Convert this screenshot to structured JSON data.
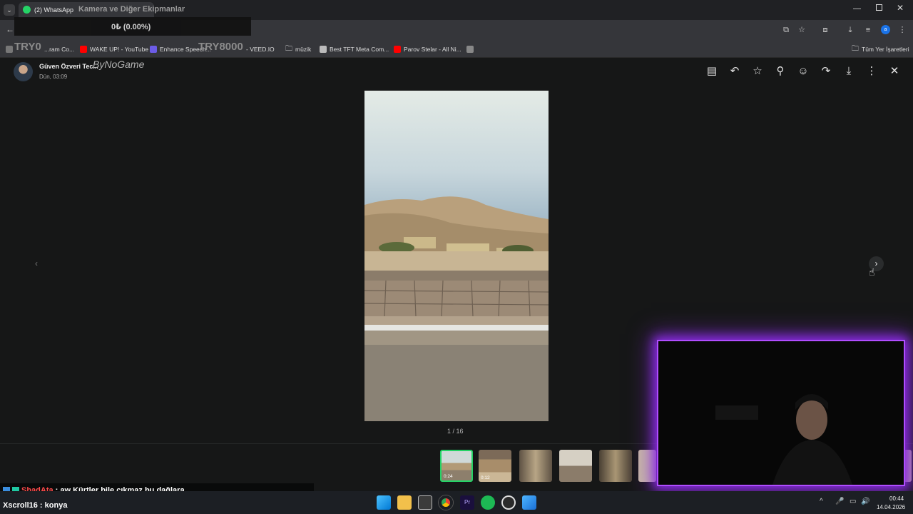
{
  "browser": {
    "tab_title": "(2) WhatsApp",
    "stream_title": "Kamera ve Diğer Ekipmanlar",
    "bookmarks": [
      {
        "label": "...ram Co...",
        "color": "#777777"
      },
      {
        "label": "WAKE UP! - YouTube",
        "color": "#ff0000"
      },
      {
        "label": "Enhance Speech...",
        "color": "#6c5ce7"
      },
      {
        "label": "- VEED.IO",
        "color": "#4caf50"
      },
      {
        "label": "müzik",
        "color": "#cccccc"
      },
      {
        "label": "Best TFT Meta Com...",
        "color": "#bbbbbb"
      },
      {
        "label": "Parov Stelar - All Ni...",
        "color": "#ff0000"
      }
    ],
    "all_bookmarks": "Tüm Yer İşaretleri"
  },
  "overlay": {
    "balance": "0₺ (0.00%)",
    "left_tag": "TRY0",
    "mid_tag": "TRY8000",
    "brand": "ByNoGame"
  },
  "viewer": {
    "sender_name": "Güven Özveri Tec...",
    "timestamp": "Dün, 03:09",
    "counter": "1 / 16",
    "thumbnails": [
      {
        "duration": "0:24",
        "selected": true
      },
      {
        "duration": "0:12",
        "selected": false
      },
      {
        "duration": "",
        "selected": false
      },
      {
        "duration": "",
        "selected": false
      },
      {
        "duration": "",
        "selected": false
      }
    ]
  },
  "chat": [
    {
      "user": "ShadAta",
      "user_color": "#ff4b4b",
      "message": ": aw Kürtler bile çıkmaz bu dağlara"
    },
    {
      "user": "Xscroll16",
      "user_color": "#ffffff",
      "message": " : konya"
    }
  ],
  "taskbar": {
    "time": "00:44",
    "date": "14.04.2026"
  },
  "icons": {
    "header": [
      "message-icon",
      "reply-icon",
      "star-icon",
      "pin-icon",
      "emoji-icon",
      "forward-icon",
      "download-icon",
      "more-icon",
      "close-icon"
    ],
    "accent": "#25d366",
    "cam_glow": "#9b30ff"
  }
}
